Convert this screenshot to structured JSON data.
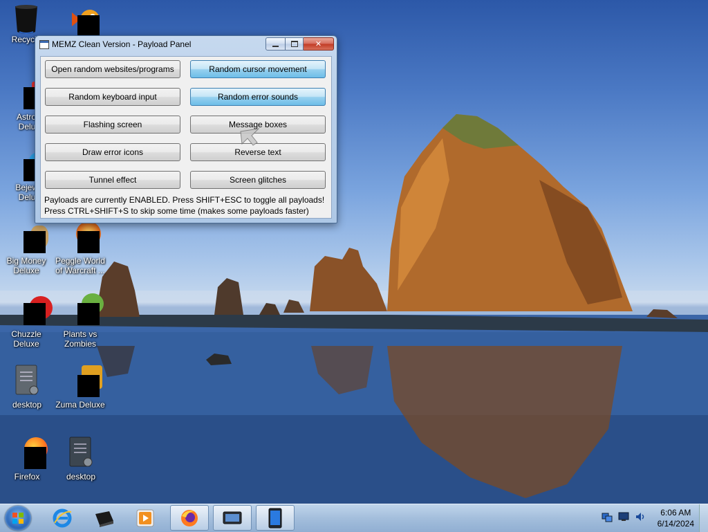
{
  "desktop": {
    "icons": [
      {
        "label": "Recycle"
      },
      {
        "label": "AstroP\nDelux"
      },
      {
        "label": "Bejewe\nDelux"
      },
      {
        "label": "Big Money\nDeluxe"
      },
      {
        "label": "Peggle World\nof Warcraft ..."
      },
      {
        "label": "Chuzzle\nDeluxe"
      },
      {
        "label": "Plants vs\nZombies"
      },
      {
        "label": "desktop"
      },
      {
        "label": "Zuma Deluxe"
      },
      {
        "label": "Firefox"
      },
      {
        "label": "desktop"
      }
    ]
  },
  "window": {
    "title": "MEMZ Clean Version - Payload Panel",
    "buttons": [
      {
        "label": "Open random websites/programs",
        "enabled": false
      },
      {
        "label": "Random cursor movement",
        "enabled": true
      },
      {
        "label": "Random keyboard input",
        "enabled": false
      },
      {
        "label": "Random error sounds",
        "enabled": true
      },
      {
        "label": "Flashing screen",
        "enabled": false
      },
      {
        "label": "Message boxes",
        "enabled": false
      },
      {
        "label": "Draw error icons",
        "enabled": false
      },
      {
        "label": "Reverse text",
        "enabled": false
      },
      {
        "label": "Tunnel effect",
        "enabled": false
      },
      {
        "label": "Screen glitches",
        "enabled": false
      }
    ],
    "status_line1": "Payloads are currently ENABLED. Press SHIFT+ESC to toggle all payloads!",
    "status_line2": "Press CTRL+SHIFT+S to skip some time (makes some payloads faster)"
  },
  "taskbar": {
    "pinned": [
      "start-button",
      "internet-explorer-icon",
      "drive-icon",
      "media-player-icon",
      "firefox-icon",
      "screen-app-icon",
      "tablet-app-icon"
    ],
    "tray_icons": [
      "network-icon",
      "display-icon",
      "volume-icon"
    ],
    "time": "6:06 AM",
    "date": "6/14/2024"
  },
  "colors": {
    "enabled_button": "#98d1ef",
    "taskbar": "#aac4e0",
    "close_button": "#c13a24"
  }
}
